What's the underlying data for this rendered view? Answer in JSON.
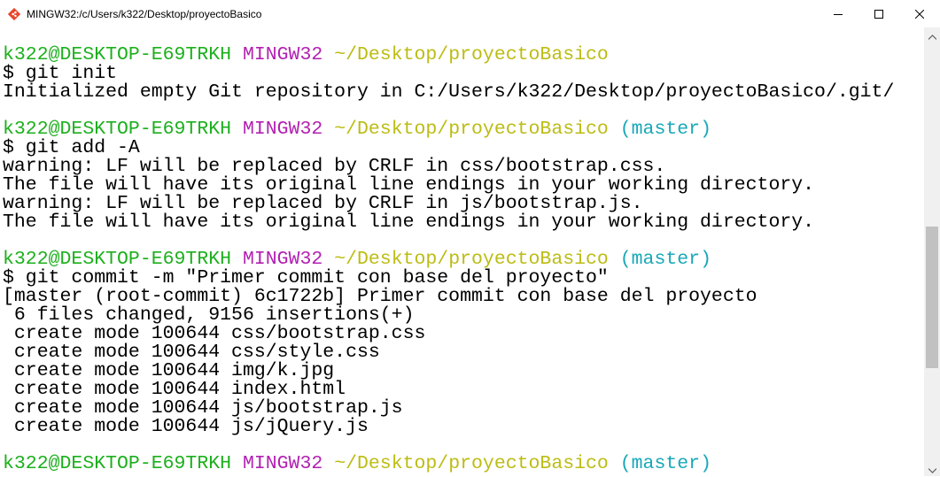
{
  "window": {
    "title": "MINGW32:/c/Users/k322/Desktop/proyectoBasico",
    "icon": "git-bash-icon",
    "controls": [
      "minimize-icon",
      "maximize-icon",
      "close-icon"
    ]
  },
  "terminal": {
    "prompt": {
      "user": "k322@DESKTOP-E69TRKH",
      "system": "MINGW32",
      "path": "~/Desktop/proyectoBasico",
      "branch": "(master)"
    },
    "cmd_init": "$ git init",
    "out_init": "Initialized empty Git repository in C:/Users/k322/Desktop/proyectoBasico/.git/",
    "cmd_add": "$ git add -A",
    "out_add": [
      "warning: LF will be replaced by CRLF in css/bootstrap.css.",
      "The file will have its original line endings in your working directory.",
      "warning: LF will be replaced by CRLF in js/bootstrap.js.",
      "The file will have its original line endings in your working directory."
    ],
    "cmd_commit": "$ git commit -m \"Primer commit con base del proyecto\"",
    "out_commit": [
      "[master (root-commit) 6c1722b] Primer commit con base del proyecto",
      " 6 files changed, 9156 insertions(+)",
      " create mode 100644 css/bootstrap.css",
      " create mode 100644 css/style.css",
      " create mode 100644 img/k.jpg",
      " create mode 100644 index.html",
      " create mode 100644 js/bootstrap.js",
      " create mode 100644 js/jQuery.js"
    ]
  },
  "colors": {
    "user": "#1cb01c",
    "system": "#b220b2",
    "path": "#bcbc14",
    "branch": "#18a8b8",
    "text": "#000000",
    "background": "#ffffff"
  }
}
